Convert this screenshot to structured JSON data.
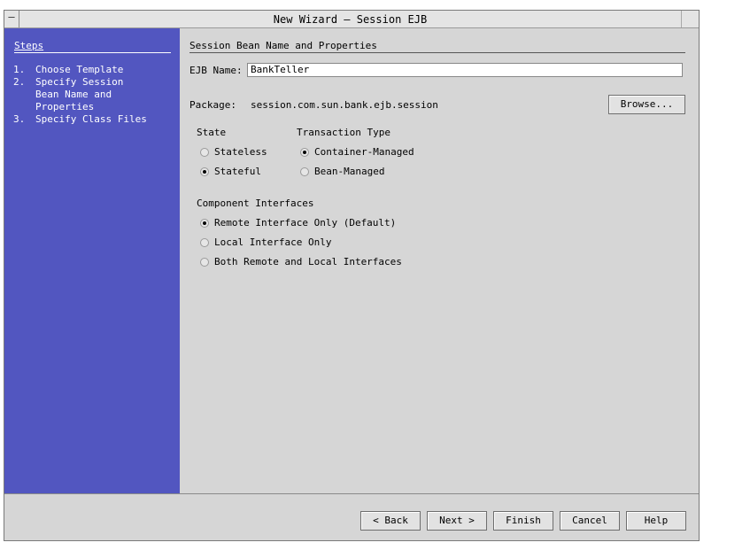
{
  "window": {
    "title": "New Wizard – Session EJB",
    "menu_glyph": "–"
  },
  "steps": {
    "heading": "Steps",
    "items": [
      {
        "num": "1.",
        "label": "Choose Template"
      },
      {
        "num": "2.",
        "label": "Specify Session Bean Name and Properties"
      },
      {
        "num": "3.",
        "label": "Specify Class Files"
      }
    ]
  },
  "panel": {
    "heading": "Session Bean Name and Properties",
    "ejb_name_label": "EJB Name:",
    "ejb_name_value": "BankTeller",
    "package_label": "Package:",
    "package_value": "session.com.sun.bank.ejb.session",
    "browse_label": "Browse...",
    "state": {
      "label": "State",
      "options": [
        {
          "label": "Stateless",
          "selected": false
        },
        {
          "label": "Stateful",
          "selected": true
        }
      ]
    },
    "transaction": {
      "label": "Transaction Type",
      "options": [
        {
          "label": "Container-Managed",
          "selected": true
        },
        {
          "label": "Bean-Managed",
          "selected": false
        }
      ]
    },
    "interfaces": {
      "label": "Component Interfaces",
      "options": [
        {
          "label": "Remote Interface Only (Default)",
          "selected": true
        },
        {
          "label": "Local Interface Only",
          "selected": false
        },
        {
          "label": "Both Remote and Local Interfaces",
          "selected": false
        }
      ]
    }
  },
  "buttons": {
    "back": "< Back",
    "next": "Next >",
    "finish": "Finish",
    "cancel": "Cancel",
    "help": "Help"
  }
}
